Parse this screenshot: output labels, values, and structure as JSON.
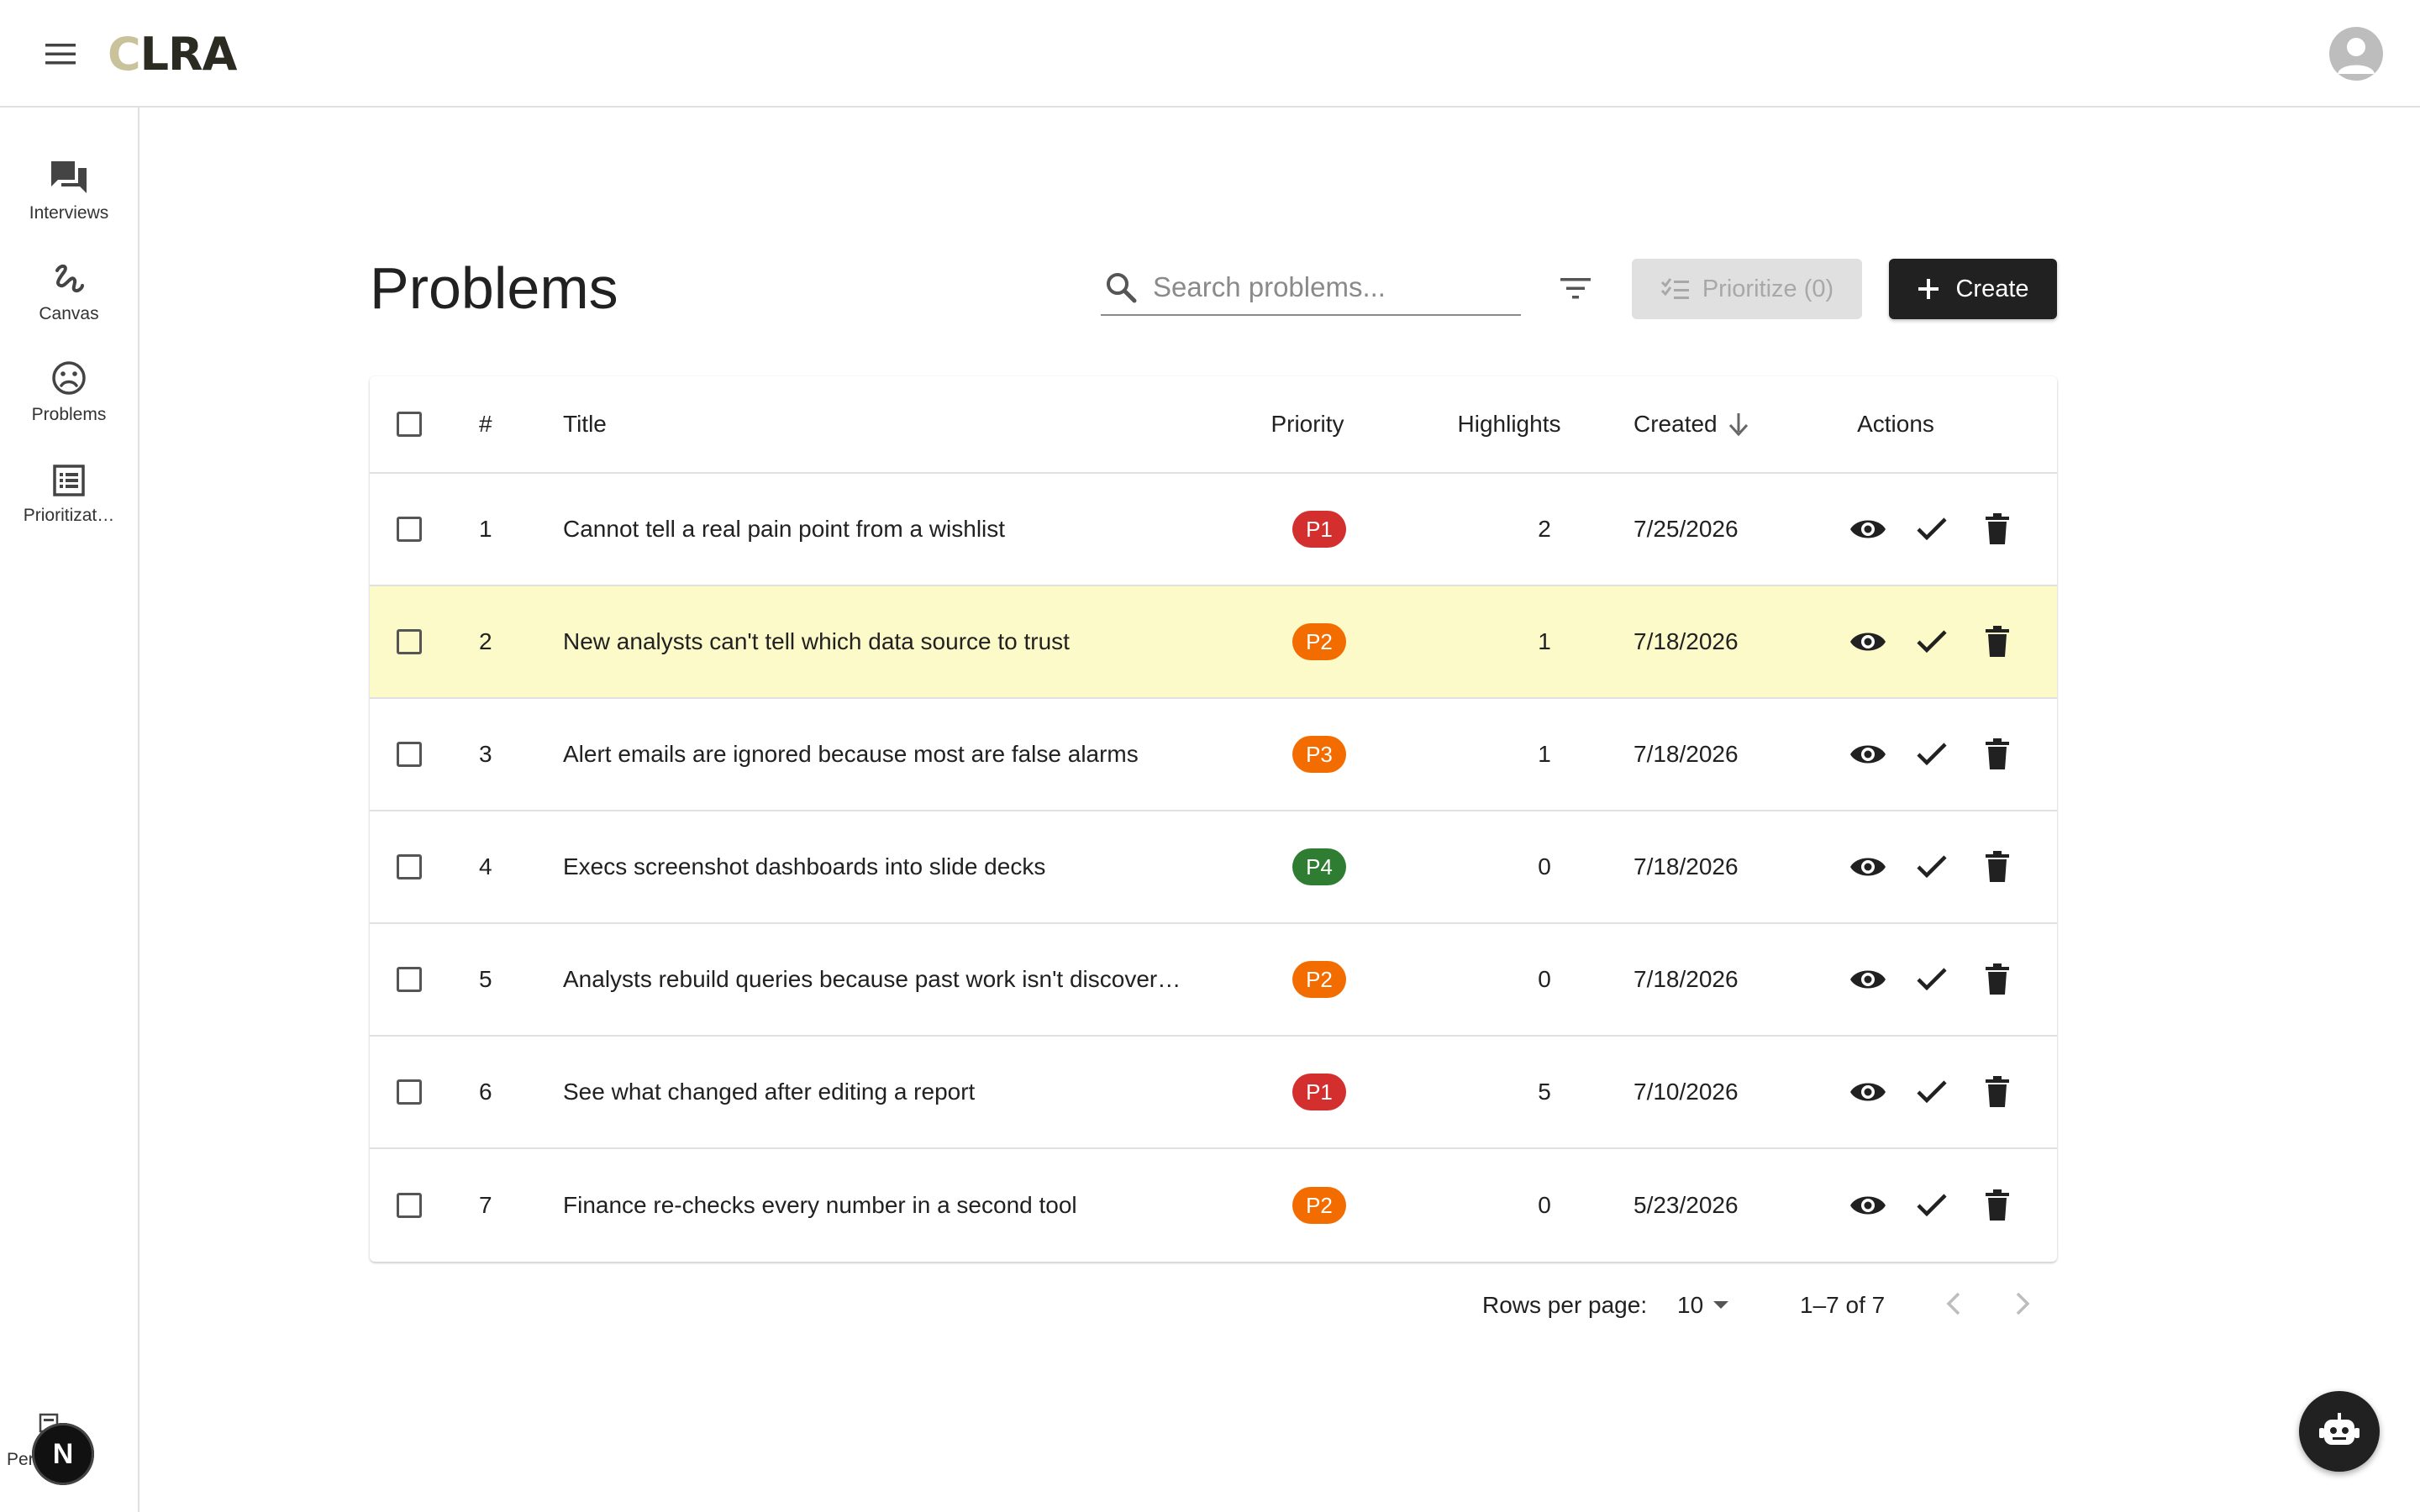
{
  "app": {
    "logo_text": "CLRA"
  },
  "sidebar": {
    "items": [
      {
        "label": "Interviews",
        "icon": "forum-icon"
      },
      {
        "label": "Canvas",
        "icon": "gesture-icon"
      },
      {
        "label": "Problems",
        "icon": "sad-face-icon"
      },
      {
        "label": "Prioritizat…",
        "icon": "list-alt-icon"
      }
    ],
    "persona": {
      "label": "Persona…",
      "badge": "N"
    }
  },
  "page": {
    "title": "Problems",
    "search": {
      "placeholder": "Search problems...",
      "value": ""
    },
    "prioritize_label": "Prioritize (0)",
    "create_label": "Create"
  },
  "table": {
    "columns": {
      "num": "#",
      "title": "Title",
      "priority": "Priority",
      "highlights": "Highlights",
      "created": "Created",
      "actions": "Actions"
    },
    "sort": {
      "column": "Created",
      "direction": "desc"
    },
    "rows": [
      {
        "num": "1",
        "title": "Cannot tell a real pain point from a wishlist",
        "priority": "P1",
        "highlights": "2",
        "created": "7/25/2026"
      },
      {
        "num": "2",
        "title": "New analysts can't tell which data source to trust",
        "priority": "P2",
        "highlights": "1",
        "created": "7/18/2026"
      },
      {
        "num": "3",
        "title": "Alert emails are ignored because most are false alarms",
        "priority": "P3",
        "highlights": "1",
        "created": "7/18/2026"
      },
      {
        "num": "4",
        "title": "Execs screenshot dashboards into slide decks",
        "priority": "P4",
        "highlights": "0",
        "created": "7/18/2026"
      },
      {
        "num": "5",
        "title": "Analysts rebuild queries because past work isn't discover…",
        "priority": "P2",
        "highlights": "0",
        "created": "7/18/2026"
      },
      {
        "num": "6",
        "title": "See what changed after editing a report",
        "priority": "P1",
        "highlights": "5",
        "created": "7/10/2026"
      },
      {
        "num": "7",
        "title": "Finance re-checks every number in a second tool",
        "priority": "P2",
        "highlights": "0",
        "created": "5/23/2026"
      }
    ],
    "highlighted_row": 2
  },
  "priority_colors": {
    "P1": "#d32f2f",
    "P2": "#f36c00",
    "P3": "#f36c00",
    "P4": "#2e7d32"
  },
  "colors": {
    "highlight_row": "#fbfac8",
    "primary_button": "#212121",
    "disabled_button": "#e0e0e0"
  },
  "pagination": {
    "rows_per_page_label": "Rows per page:",
    "rows_per_page": "10",
    "range": "1–7 of 7"
  },
  "fab": {
    "icon": "smart-toy-icon"
  }
}
